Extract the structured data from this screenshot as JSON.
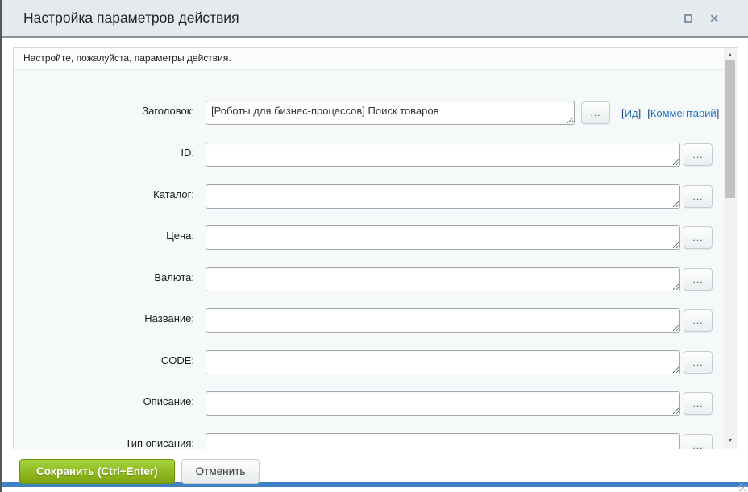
{
  "window": {
    "title": "Настройка параметров действия",
    "controls": {
      "maximize_icon": "square-outline",
      "close_glyph": "✕"
    }
  },
  "info_bar": {
    "message": "Настройте, пожалуйста, параметры действия."
  },
  "fields": [
    {
      "label": "Заголовок:",
      "value": "[Роботы для бизнес-процессов] Поиск товаров",
      "browse_label": "...",
      "links": {
        "id": {
          "open": "[",
          "text": "Ид",
          "close": "]"
        },
        "comment": {
          "open": "[",
          "text": "Комментарий",
          "close": "]"
        }
      }
    },
    {
      "label": "ID:",
      "value": "",
      "browse_label": "..."
    },
    {
      "label": "Каталог:",
      "value": "",
      "browse_label": "..."
    },
    {
      "label": "Цена:",
      "value": "",
      "browse_label": "..."
    },
    {
      "label": "Валюта:",
      "value": "",
      "browse_label": "..."
    },
    {
      "label": "Название:",
      "value": "",
      "browse_label": "..."
    },
    {
      "label": "CODE:",
      "value": "",
      "browse_label": "..."
    },
    {
      "label": "Описание:",
      "value": "",
      "browse_label": "..."
    },
    {
      "label": "Тип описания:",
      "value": "",
      "browse_label": "..."
    }
  ],
  "scrollbar": {
    "up_glyph": "▲",
    "down_glyph": "▼"
  },
  "footer": {
    "save_label": "Сохранить (Ctrl+Enter)",
    "cancel_label": "Отменить"
  },
  "colors": {
    "titlebar_bg": "#e4eaee",
    "accent_green": "#7ea30a",
    "accent_green_light": "#a6d440",
    "link_blue": "#2272c4",
    "bottom_bar_blue": "#3e81c4"
  }
}
